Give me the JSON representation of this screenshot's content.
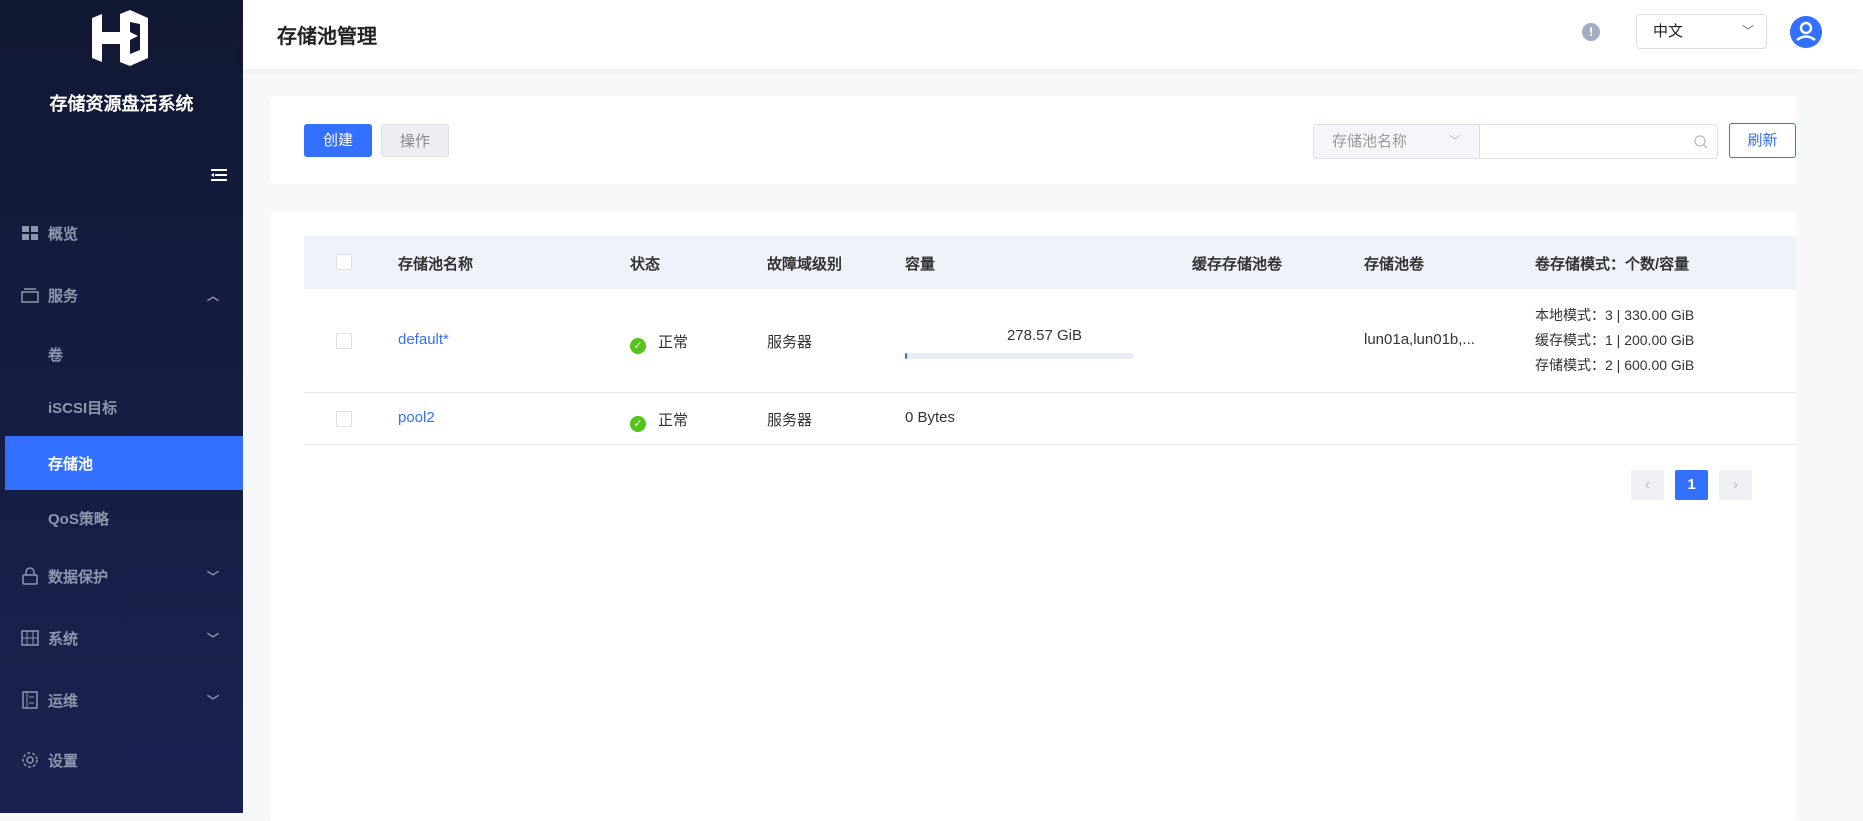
{
  "sidebar": {
    "system_title": "存储资源盘活系统",
    "items": [
      {
        "label": "概览"
      },
      {
        "label": "服务"
      },
      {
        "label": "卷"
      },
      {
        "label": "iSCSI目标"
      },
      {
        "label": "存储池"
      },
      {
        "label": "QoS策略"
      },
      {
        "label": "数据保护"
      },
      {
        "label": "系统"
      },
      {
        "label": "运维"
      },
      {
        "label": "设置"
      }
    ]
  },
  "header": {
    "title": "存储池管理",
    "language": "中文"
  },
  "toolbar": {
    "create": "创建",
    "operate": "操作",
    "search_field": "存储池名称",
    "search_placeholder": "",
    "refresh": "刷新"
  },
  "table": {
    "columns": [
      "存储池名称",
      "状态",
      "故障域级别",
      "容量",
      "缓存存储池卷",
      "存储池卷",
      "卷存储模式：个数/容量"
    ],
    "rows": [
      {
        "name": "default*",
        "status": "正常",
        "fault_domain": "服务器",
        "capacity": "278.57 GiB",
        "capacity_used_fraction": 0.01,
        "cache_volume": "",
        "pool_volumes": "lun01a,lun01b,...",
        "modes": [
          "本地模式：3 | 330.00 GiB",
          "缓存模式：1 | 200.00 GiB",
          "存储模式：2 | 600.00 GiB"
        ]
      },
      {
        "name": "pool2",
        "status": "正常",
        "fault_domain": "服务器",
        "capacity": "0 Bytes",
        "cache_volume": "",
        "pool_volumes": "",
        "modes": []
      }
    ]
  },
  "pagination": {
    "current": "1"
  },
  "colors": {
    "accent": "#3370ff",
    "success": "#52c41a"
  }
}
